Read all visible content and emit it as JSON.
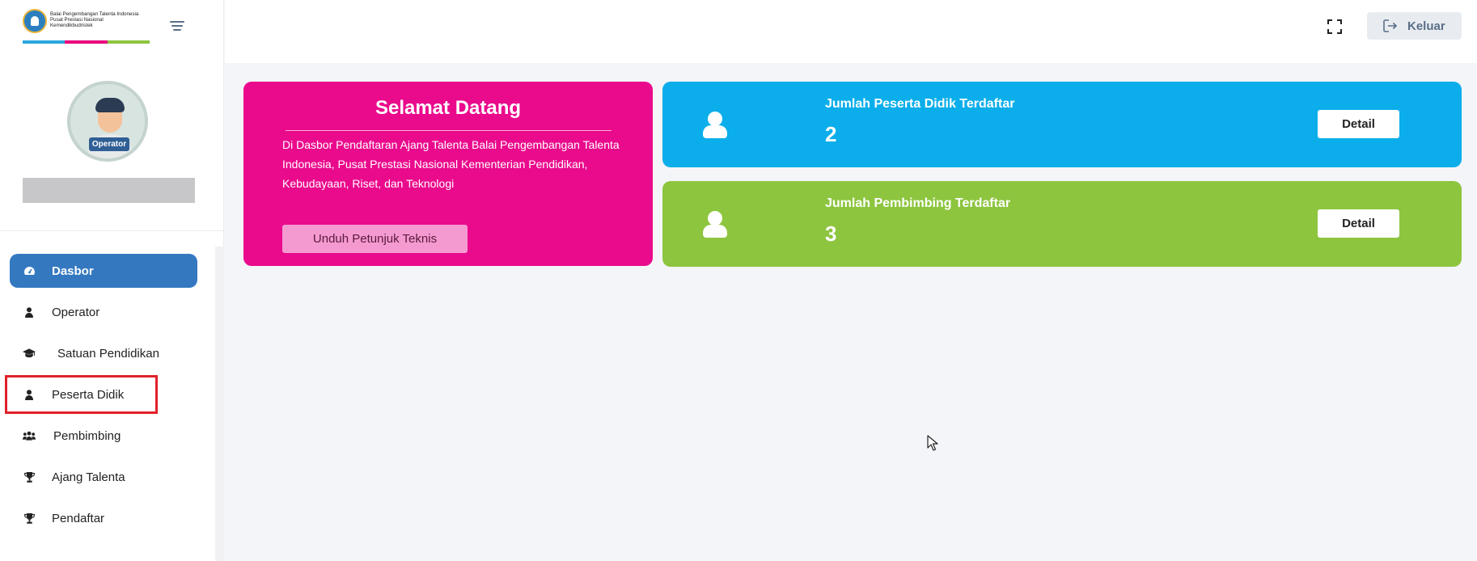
{
  "brand": {
    "lines": [
      "Balai Pengembangan Talenta Indonesia",
      "Pusat Prestasi Nasional",
      "Kemendikbudristek"
    ],
    "stripe_colors": [
      "#2aa7df",
      "#e6007e",
      "#8dc53f"
    ]
  },
  "profile": {
    "role_badge": "Operator"
  },
  "sidebar": {
    "items": [
      {
        "label": "Dasbor",
        "icon": "dashboard-icon",
        "active": true
      },
      {
        "label": "Operator",
        "icon": "user-icon"
      },
      {
        "label": "Satuan Pendidikan",
        "icon": "graduation-cap-icon"
      },
      {
        "label": "Peserta Didik",
        "icon": "user-icon",
        "highlighted": true
      },
      {
        "label": "Pembimbing",
        "icon": "users-icon"
      },
      {
        "label": "Ajang Talenta",
        "icon": "trophy-icon"
      },
      {
        "label": "Pendaftar",
        "icon": "trophy-icon"
      }
    ]
  },
  "topbar": {
    "fullscreen_icon": "fullscreen-icon",
    "logout_label": "Keluar",
    "logout_icon": "logout-icon"
  },
  "welcome": {
    "title": "Selamat Datang",
    "text": "Di Dasbor Pendaftaran Ajang Talenta Balai Pengembangan Talenta Indonesia, Pusat Prestasi Nasional Kementerian Pendidikan, Kebudayaan, Riset, dan Teknologi",
    "button_label": "Unduh Petunjuk Teknis",
    "color": "#ea0a8c"
  },
  "stats": [
    {
      "title": "Jumlah Peserta Didik Terdaftar",
      "value": "2",
      "button_label": "Detail",
      "color": "#0baeea"
    },
    {
      "title": "Jumlah Pembimbing Terdaftar",
      "value": "3",
      "button_label": "Detail",
      "color": "#8dc53f"
    }
  ]
}
